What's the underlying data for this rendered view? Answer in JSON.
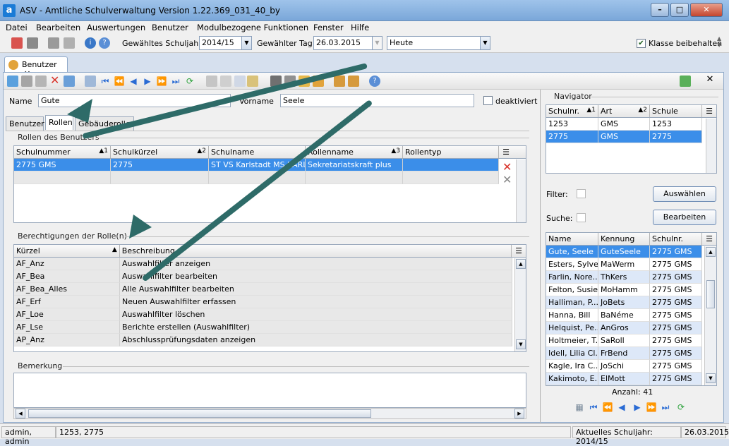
{
  "window": {
    "title": "ASV - Amtliche Schulverwaltung Version 1.22.369_031_40_by",
    "app_icon": "a"
  },
  "menu": [
    "Datei",
    "Bearbeiten",
    "Auswertungen",
    "Benutzer",
    "Modulbezogene Funktionen",
    "Fenster",
    "Hilfe"
  ],
  "toolbar": {
    "schuljahr_label": "Gewähltes Schuljahr",
    "schuljahr_value": "2014/15",
    "tag_label": "Gewählter Tag",
    "tag_value": "26.03.2015",
    "heute_value": "Heute",
    "klasse_label": "Klasse beibehalten",
    "klasse_checked": "✔"
  },
  "doc_tab": {
    "label": "Benutzer",
    "close": "✕"
  },
  "form": {
    "name_label": "Name",
    "name_value": "Gute",
    "vorname_label": "Vorname",
    "vorname_value": "Seele",
    "deaktiviert_label": "deaktiviert",
    "close_x": "✕"
  },
  "subtabs": [
    "Benutzer",
    "Rollen",
    "Gebäuderollen"
  ],
  "rollen": {
    "group_title": "Rollen des Benutzers",
    "columns": [
      {
        "label": "Schulnummer",
        "sort": "▲1"
      },
      {
        "label": "Schulkürzel",
        "sort": "▲2"
      },
      {
        "label": "Schulname",
        "sort": ""
      },
      {
        "label": "Rollenname",
        "sort": "▲3"
      },
      {
        "label": "Rollentyp",
        "sort": ""
      }
    ],
    "rows": [
      [
        "2775 GMS",
        "2775",
        "ST VS Karlstadt MS KARL...",
        "Sekretariatskraft plus",
        ""
      ]
    ]
  },
  "berechtigungen": {
    "group_title": "Berechtigungen der Rolle(n)",
    "columns": [
      {
        "label": "Kürzel",
        "sort": "▲"
      },
      {
        "label": "Beschreibung",
        "sort": ""
      }
    ],
    "rows": [
      [
        "AF_Anz",
        "Auswahlfilter anzeigen"
      ],
      [
        "AF_Bea",
        "Auswahlfilter bearbeiten"
      ],
      [
        "AF_Bea_Alles",
        "Alle Auswahlfilter bearbeiten"
      ],
      [
        "AF_Erf",
        "Neuen Auswahlfilter erfassen"
      ],
      [
        "AF_Loe",
        "Auswahlfilter löschen"
      ],
      [
        "AF_Lse",
        "Berichte erstellen (Auswahlfilter)"
      ],
      [
        "AP_Anz",
        "Abschlussprüfungsdaten anzeigen"
      ]
    ]
  },
  "bemerkung": {
    "group_title": "Bemerkung",
    "value": ""
  },
  "navigator": {
    "title": "Navigator",
    "school_columns": [
      {
        "label": "Schulnr.",
        "sort": "▲1"
      },
      {
        "label": "Art",
        "sort": "▲2"
      },
      {
        "label": "Schule",
        "sort": ""
      }
    ],
    "schools": [
      [
        "1253",
        "GMS",
        "1253"
      ],
      [
        "2775",
        "GMS",
        "2775"
      ]
    ],
    "filter_label": "Filter:",
    "suche_label": "Suche:",
    "auswaehlen_label": "Auswählen",
    "bearbeiten_label": "Bearbeiten",
    "user_columns": [
      {
        "label": "Name"
      },
      {
        "label": "Kennung"
      },
      {
        "label": "Schulnr."
      }
    ],
    "users": [
      [
        "Gute, Seele",
        "GuteSeele",
        "2775 GMS"
      ],
      [
        "Esters, Sylve...",
        "MaWerm",
        "2775 GMS"
      ],
      [
        "Farlin, Nore...",
        "ThKers",
        "2775 GMS"
      ],
      [
        "Felton, Susie",
        "MoHamm",
        "2775 GMS"
      ],
      [
        "Halliman, P...",
        "JoBets",
        "2775 GMS"
      ],
      [
        "Hanna, Bill",
        "BaNéme",
        "2775 GMS"
      ],
      [
        "Helquist, Pe...",
        "AnGros",
        "2775 GMS"
      ],
      [
        "Holtmeier, T...",
        "SaRoll",
        "2775 GMS"
      ],
      [
        "Idell, Lilia Cl...",
        "FrBend",
        "2775 GMS"
      ],
      [
        "Kagle, Ira C...",
        "JoSchi",
        "2775 GMS"
      ],
      [
        "Kakimoto, E...",
        "ElMott",
        "2775 GMS"
      ]
    ],
    "anzahl": "Anzahl: 41"
  },
  "status": {
    "user": "admin, admin",
    "schools": "1253, 2775",
    "schuljahr": "Aktuelles Schuljahr: 2014/15",
    "date": "26.03.2015"
  }
}
